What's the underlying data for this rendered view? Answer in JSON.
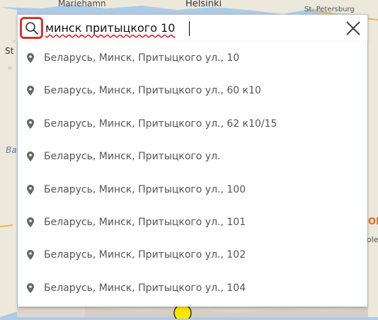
{
  "map": {
    "labels": {
      "mariehamn": "Mariehamn",
      "helsinki": "Helsinki",
      "stpete": "St. Petersburg",
      "st": "St",
      "ba": "Ba",
      "oh": "ОН",
      "ole": "ole"
    },
    "colors": {
      "sea": "#aecbe6",
      "land": "#ece9dc",
      "marker": "#ffe600"
    }
  },
  "search": {
    "value": "минск притыцкого 10",
    "icon": "search-icon",
    "close_icon": "close-icon",
    "highlight_color": "#e0302a"
  },
  "suggestions": [
    {
      "label": "Беларусь, Минск, Притыцкого ул., 10",
      "icon": "map-pin-icon"
    },
    {
      "label": "Беларусь, Минск, Притыцкого ул., 60 к10",
      "icon": "map-pin-icon"
    },
    {
      "label": "Беларусь, Минск, Притыцкого ул., 62 к10/15",
      "icon": "map-pin-icon"
    },
    {
      "label": "Беларусь, Минск, Притыцкого ул.",
      "icon": "map-pin-icon"
    },
    {
      "label": "Беларусь, Минск, Притыцкого ул., 100",
      "icon": "map-pin-icon"
    },
    {
      "label": "Беларусь, Минск, Притыцкого ул., 101",
      "icon": "map-pin-icon"
    },
    {
      "label": "Беларусь, Минск, Притыцкого ул., 102",
      "icon": "map-pin-icon"
    },
    {
      "label": "Беларусь, Минск, Притыцкого ул., 104",
      "icon": "map-pin-icon"
    }
  ]
}
